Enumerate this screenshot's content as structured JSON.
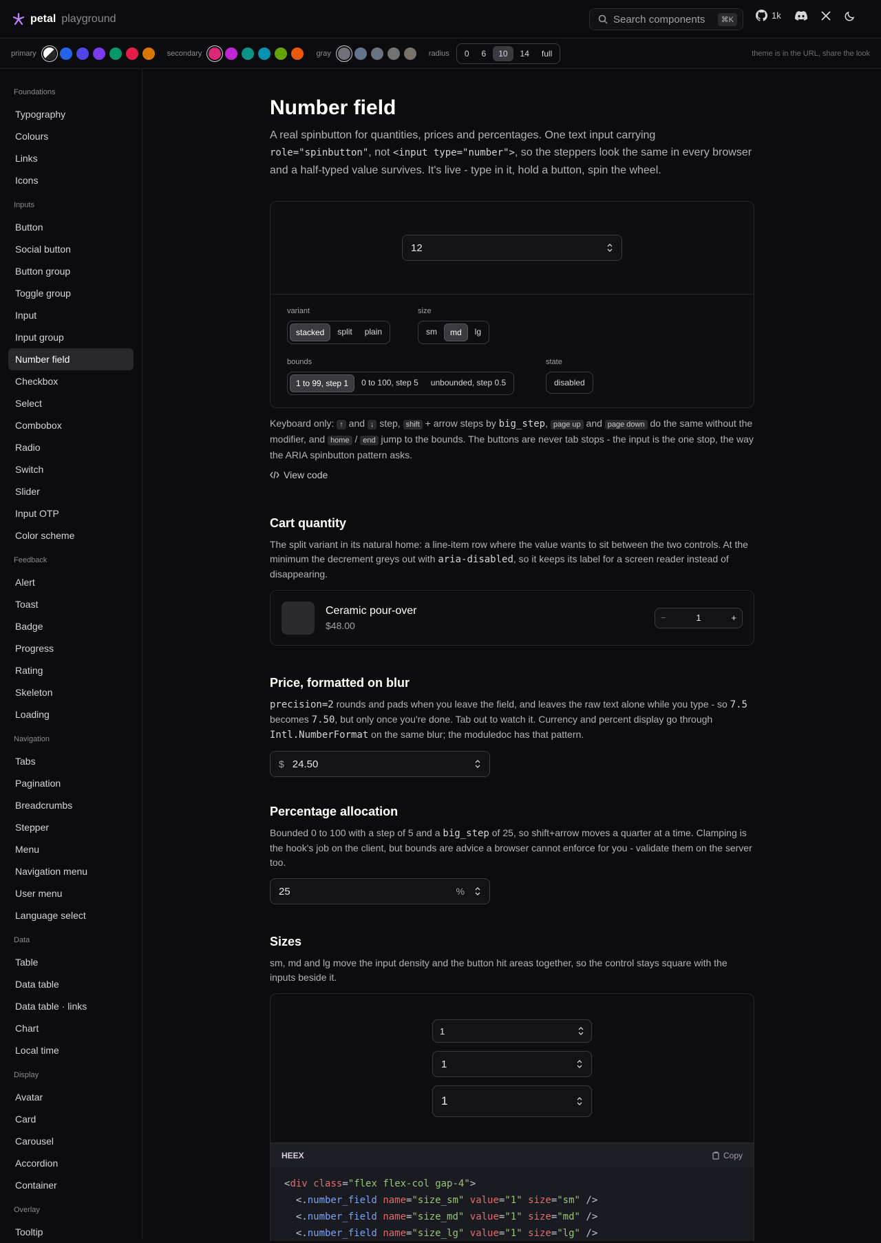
{
  "brand": {
    "name": "petal",
    "sub": "playground"
  },
  "search": {
    "placeholder": "Search components",
    "shortcut": "⌘K"
  },
  "top": {
    "github_count": "1k"
  },
  "theme": {
    "primary_label": "primary",
    "secondary_label": "secondary",
    "gray_label": "gray",
    "radius_label": "radius",
    "primary_colors": [
      "#2563eb",
      "#4f46e5",
      "#7c3aed",
      "#059669",
      "#e11d48",
      "#d97706"
    ],
    "secondary_colors": [
      "#db2777",
      "#c026d3",
      "#0d9488",
      "#0891b2",
      "#65a30d",
      "#ea580c"
    ],
    "gray_colors": [
      "#71717a",
      "#64748b",
      "#6b7280",
      "#737373",
      "#78716c"
    ],
    "radius_options": [
      "0",
      "6",
      "10",
      "14",
      "full"
    ],
    "radius_selected": "10",
    "note": "theme is in the URL, share the look"
  },
  "sidebar": {
    "sections": [
      {
        "title": "Foundations",
        "items": [
          "Typography",
          "Colours",
          "Links",
          "Icons"
        ]
      },
      {
        "title": "Inputs",
        "items": [
          "Button",
          "Social button",
          "Button group",
          "Toggle group",
          "Input",
          "Input group",
          "Number field",
          "Checkbox",
          "Select",
          "Combobox",
          "Radio",
          "Switch",
          "Slider",
          "Input OTP",
          "Color scheme"
        ]
      },
      {
        "title": "Feedback",
        "items": [
          "Alert",
          "Toast",
          "Badge",
          "Progress",
          "Rating",
          "Skeleton",
          "Loading"
        ]
      },
      {
        "title": "Navigation",
        "items": [
          "Tabs",
          "Pagination",
          "Breadcrumbs",
          "Stepper",
          "Menu",
          "Navigation menu",
          "User menu",
          "Language select"
        ]
      },
      {
        "title": "Data",
        "items": [
          "Table",
          "Data table",
          "Data table · links",
          "Chart",
          "Local time"
        ]
      },
      {
        "title": "Display",
        "items": [
          "Avatar",
          "Card",
          "Carousel",
          "Accordion",
          "Container"
        ]
      },
      {
        "title": "Overlay",
        "items": [
          "Tooltip"
        ]
      }
    ],
    "active": "Number field"
  },
  "page": {
    "title": "Number field",
    "lead_1": "A real spinbutton for quantities, prices and percentages. One text input carrying ",
    "lead_code1": "role=\"spinbutton\"",
    "lead_2": ", not ",
    "lead_code2": "<input type=\"number\">",
    "lead_3": ", so the steppers look the same in every browser and a half-typed value survives. It's live - type in it, hold a button, spin the wheel."
  },
  "demo": {
    "value": "12",
    "variant_label": "variant",
    "variants": [
      "stacked",
      "split",
      "plain"
    ],
    "variant_selected": "stacked",
    "size_label": "size",
    "sizes": [
      "sm",
      "md",
      "lg"
    ],
    "size_selected": "md",
    "bounds_label": "bounds",
    "bounds": [
      "1 to 99, step 1",
      "0 to 100, step 5",
      "unbounded, step 0.5"
    ],
    "bounds_selected": "1 to 99, step 1",
    "state_label": "state",
    "states": [
      "disabled"
    ]
  },
  "keyboard": {
    "t1": "Keyboard only: ",
    "k_up": "↑",
    "t2": " and ",
    "k_down": "↓",
    "t3": " step, ",
    "k_shift": "shift",
    "t4": " + arrow steps by ",
    "c_big": "big_step",
    "t5": ", ",
    "k_pgup": "page up",
    "t6": " and ",
    "k_pgdn": "page down",
    "t7": " do the same without the modifier, and ",
    "k_home": "home",
    "t8": " / ",
    "k_end": "end",
    "t9": " jump to the bounds. The buttons are never tab stops - the input is the one stop, the way the ARIA spinbutton pattern asks.",
    "view_code": "View code"
  },
  "cart": {
    "title": "Cart quantity",
    "d1": "The split variant in its natural home: a line-item row where the value wants to sit between the two controls. At the minimum the decrement greys out with ",
    "dc": "aria-disabled",
    "d2": ", so it keeps its label for a screen reader instead of disappearing.",
    "product": "Ceramic pour-over",
    "price": "$48.00",
    "qty": "1"
  },
  "price": {
    "title": "Price, formatted on blur",
    "c1": "precision=2",
    "d1": " rounds and pads when you leave the field, and leaves the raw text alone while you type - so ",
    "c2": "7.5",
    "d2": " becomes ",
    "c3": "7.50",
    "d3": ", but only once you're done. Tab out to watch it. Currency and percent display go through ",
    "c4": "Intl.NumberFormat",
    "d4": " on the same blur; the moduledoc has that pattern.",
    "prefix": "$",
    "value": "24.50"
  },
  "pct": {
    "title": "Percentage allocation",
    "d1": "Bounded 0 to 100 with a step of 5 and a ",
    "c1": "big_step",
    "d2": " of 25, so shift+arrow moves a quarter at a time. Clamping is the hook's job on the client, but bounds are advice a browser cannot enforce for you - validate them on the server too.",
    "value": "25",
    "suffix": "%"
  },
  "sizes": {
    "title": "Sizes",
    "desc": "sm, md and lg move the input density and the button hit areas together, so the control stays square with the inputs beside it.",
    "values": [
      "1",
      "1",
      "1"
    ],
    "code_label": "HEEX",
    "copy": "Copy"
  }
}
